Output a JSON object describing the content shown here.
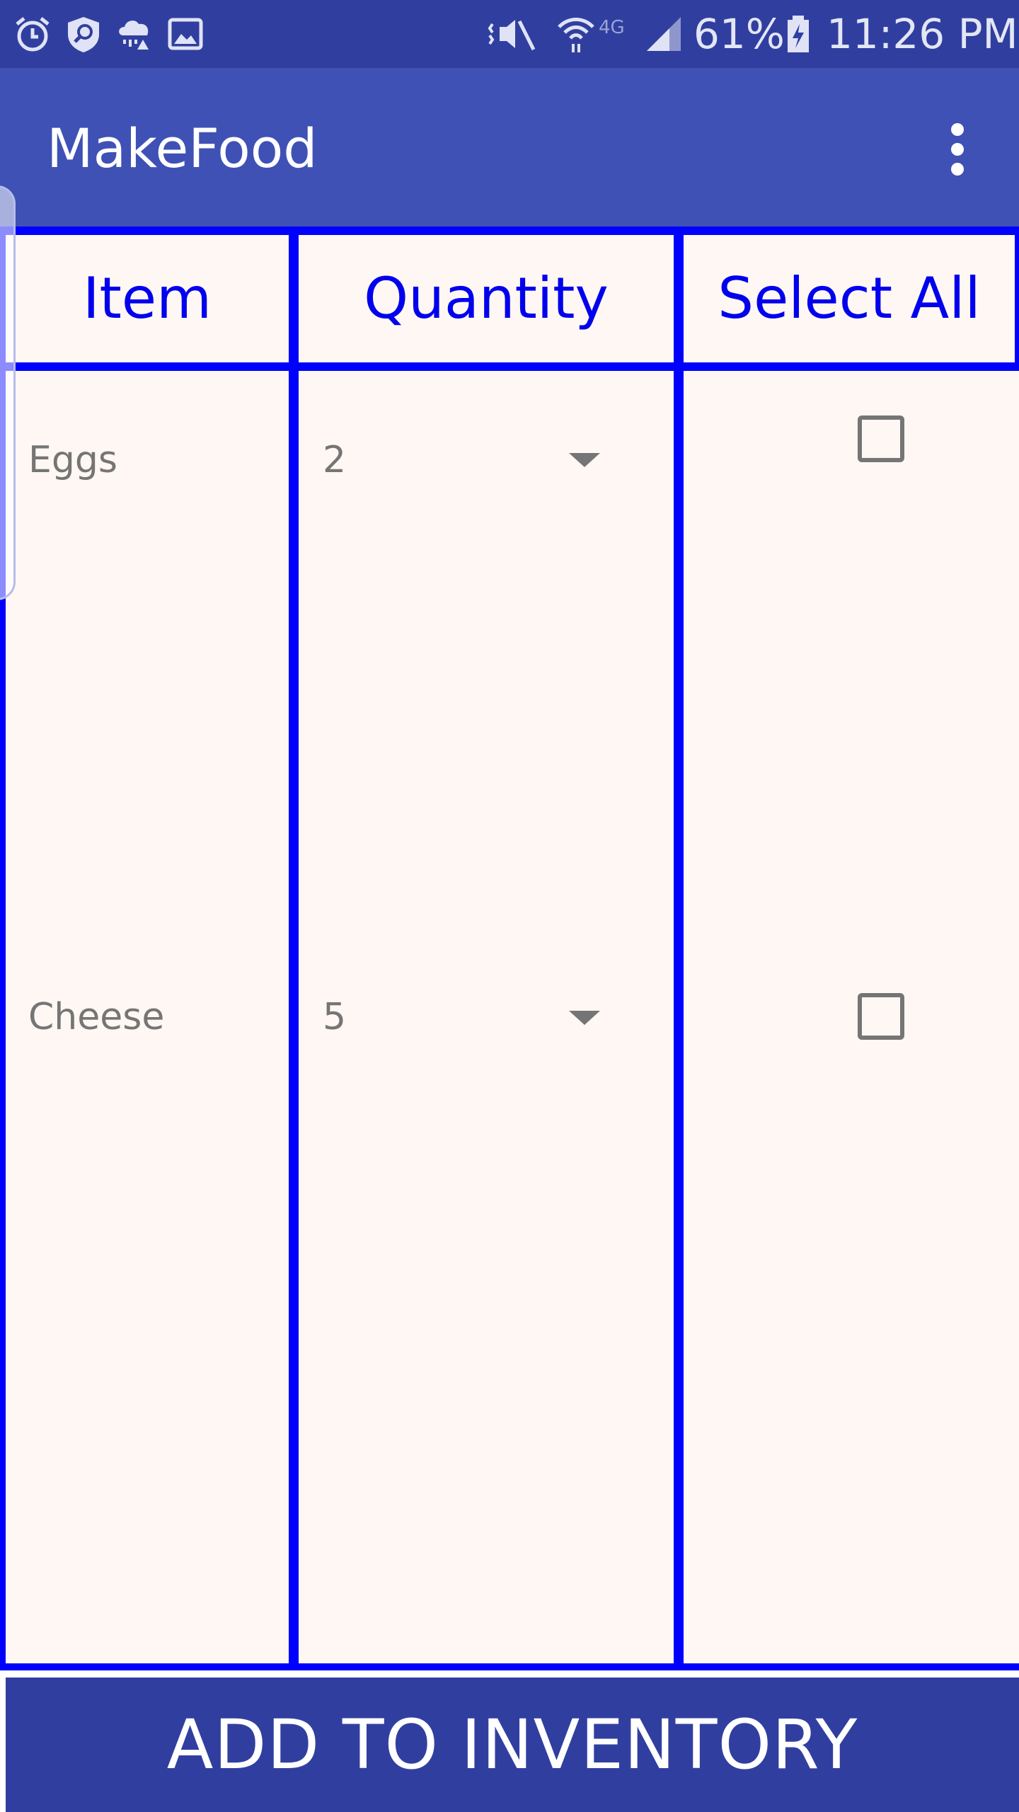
{
  "status_bar": {
    "icons": [
      "alarm-icon",
      "shield-search-icon",
      "weather-alert-icon",
      "image-icon",
      "mute-icon",
      "wifi-icon",
      "4g-icon",
      "signal-icon",
      "battery-charging-icon"
    ],
    "battery": "61%",
    "network": "4G",
    "time": "11:26 PM"
  },
  "app_bar": {
    "title": "MakeFood",
    "menu_icon": "more-vert-icon"
  },
  "table": {
    "headers": [
      "Item",
      "Quantity",
      "Select All"
    ],
    "rows": [
      {
        "item": "Eggs",
        "quantity": "2",
        "checked": false
      },
      {
        "item": "Cheese",
        "quantity": "5",
        "checked": false
      }
    ],
    "border_color": "#0000ff",
    "header_text_color": "#0000ee",
    "background_color": "#fff7f3"
  },
  "footer": {
    "button_label": "ADD TO INVENTORY"
  },
  "colors": {
    "status_bar": "#303f9f",
    "app_bar": "#3f51b5",
    "button": "#303f9f"
  }
}
